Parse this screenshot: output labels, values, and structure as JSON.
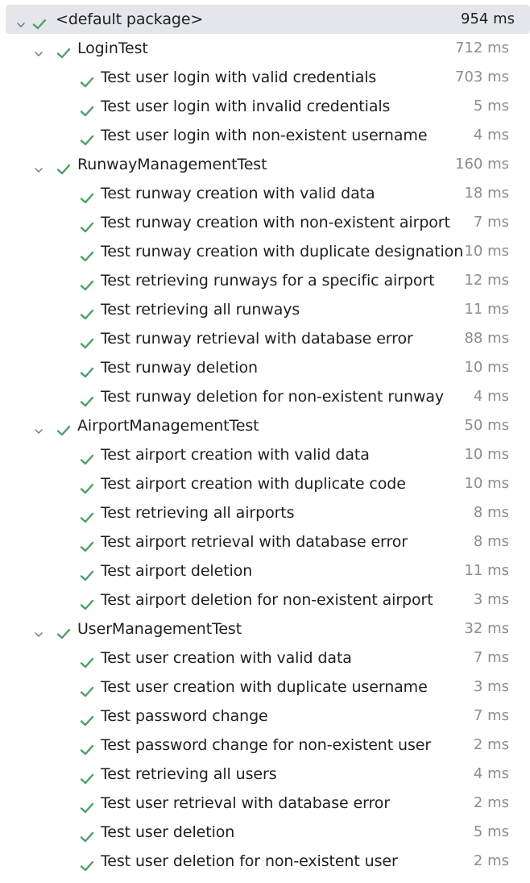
{
  "colors": {
    "check": "#4aa067",
    "chevron": "#6f737a",
    "time": "#8a8d93",
    "selected_row": "#e4e6eb"
  },
  "icons": {
    "expand": "chevron-down-icon",
    "status": "check-icon"
  },
  "tree": {
    "label": "<default package>",
    "time": "954 ms",
    "suites": [
      {
        "label": "LoginTest",
        "time": "712 ms",
        "tests": [
          {
            "label": "Test user login with valid credentials",
            "time": "703 ms"
          },
          {
            "label": "Test user login with invalid credentials",
            "time": "5 ms"
          },
          {
            "label": "Test user login with non-existent username",
            "time": "4 ms"
          }
        ]
      },
      {
        "label": "RunwayManagementTest",
        "time": "160 ms",
        "tests": [
          {
            "label": "Test runway creation with valid data",
            "time": "18 ms"
          },
          {
            "label": "Test runway creation with non-existent airport",
            "time": "7 ms"
          },
          {
            "label": "Test runway creation with duplicate designation",
            "time": "10 ms"
          },
          {
            "label": "Test retrieving runways for a specific airport",
            "time": "12 ms"
          },
          {
            "label": "Test retrieving all runways",
            "time": "11 ms"
          },
          {
            "label": "Test runway retrieval with database error",
            "time": "88 ms"
          },
          {
            "label": "Test runway deletion",
            "time": "10 ms"
          },
          {
            "label": "Test runway deletion for non-existent runway",
            "time": "4 ms"
          }
        ]
      },
      {
        "label": "AirportManagementTest",
        "time": "50 ms",
        "tests": [
          {
            "label": "Test airport creation with valid data",
            "time": "10 ms"
          },
          {
            "label": "Test airport creation with duplicate code",
            "time": "10 ms"
          },
          {
            "label": "Test retrieving all airports",
            "time": "8 ms"
          },
          {
            "label": "Test airport retrieval with database error",
            "time": "8 ms"
          },
          {
            "label": "Test airport deletion",
            "time": "11 ms"
          },
          {
            "label": "Test airport deletion for non-existent airport",
            "time": "3 ms"
          }
        ]
      },
      {
        "label": "UserManagementTest",
        "time": "32 ms",
        "tests": [
          {
            "label": "Test user creation with valid data",
            "time": "7 ms"
          },
          {
            "label": "Test user creation with duplicate username",
            "time": "3 ms"
          },
          {
            "label": "Test password change",
            "time": "7 ms"
          },
          {
            "label": "Test password change for non-existent user",
            "time": "2 ms"
          },
          {
            "label": "Test retrieving all users",
            "time": "4 ms"
          },
          {
            "label": "Test user retrieval with database error",
            "time": "2 ms"
          },
          {
            "label": "Test user deletion",
            "time": "5 ms"
          },
          {
            "label": "Test user deletion for non-existent user",
            "time": "2 ms"
          }
        ]
      }
    ]
  }
}
